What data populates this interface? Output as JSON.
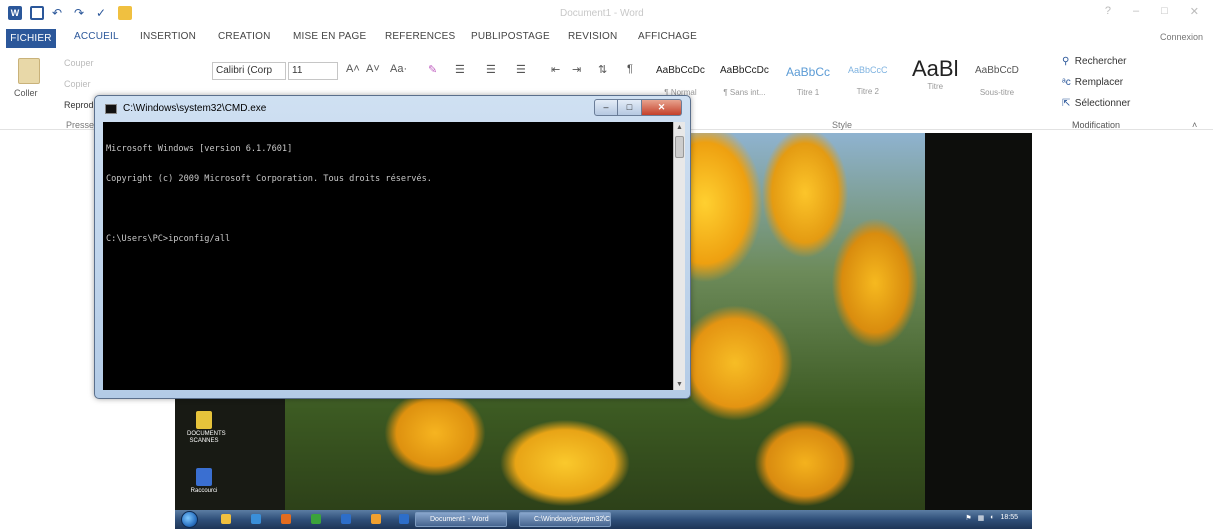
{
  "word": {
    "doc_title": "Document1 - Word",
    "window_controls": [
      "?",
      "–",
      "□",
      "✕"
    ],
    "tabs": {
      "fichier": "FICHIER",
      "accueil": "ACCUEIL",
      "insertion": "INSERTION",
      "creation": "CREATION",
      "mise_en_page": "MISE EN PAGE",
      "references": "REFERENCES",
      "publipostage": "PUBLIPOSTAGE",
      "revision": "REVISION",
      "affichage": "AFFICHAGE"
    },
    "connexion": "Connexion",
    "clipboard": {
      "paste": "Coller",
      "cut": "Couper",
      "copy": "Copier",
      "format_painter": "Reprod",
      "group": "Presse"
    },
    "font": {
      "family": "Calibri (Corp",
      "size": "11"
    },
    "styles": {
      "group": "Style",
      "tiles": [
        {
          "sample": "AaBbCcDc",
          "label": "¶ Normal"
        },
        {
          "sample": "AaBbCcDc",
          "label": "¶ Sans int..."
        },
        {
          "sample": "AaBbCc",
          "label": "Titre 1"
        },
        {
          "sample": "AaBbCcC",
          "label": "Titre 2"
        },
        {
          "sample": "AaBl",
          "label": "Titre"
        },
        {
          "sample": "AaBbCcD",
          "label": "Sous-titre"
        }
      ]
    },
    "editing": {
      "find": "Rechercher",
      "replace": "Remplacer",
      "select": "Sélectionner",
      "group": "Modification"
    }
  },
  "desktop": {
    "icons": [
      {
        "label": "DOCUMENTS SCANNES",
        "color": "#e6c33b",
        "icon": "folder-icon"
      },
      {
        "label": "Raccourci",
        "color": "#3a6fd1",
        "icon": "program-icon"
      }
    ],
    "taskbar": {
      "buttons": [
        "Document1 - Word",
        "C:\\Windows\\system32\\CMD.exe"
      ],
      "clock": "18:55"
    }
  },
  "cmd": {
    "title": "C:\\Windows\\system32\\CMD.exe",
    "lines": [
      "Microsoft Windows [version 6.1.7601]",
      "Copyright (c) 2009 Microsoft Corporation. Tous droits réservés.",
      "",
      "C:\\Users\\PC>ipconfig/all"
    ]
  },
  "colors": {
    "word_accent": "#2b579a",
    "cmd_background": "#000000",
    "cmd_text": "#c8c8c8"
  }
}
